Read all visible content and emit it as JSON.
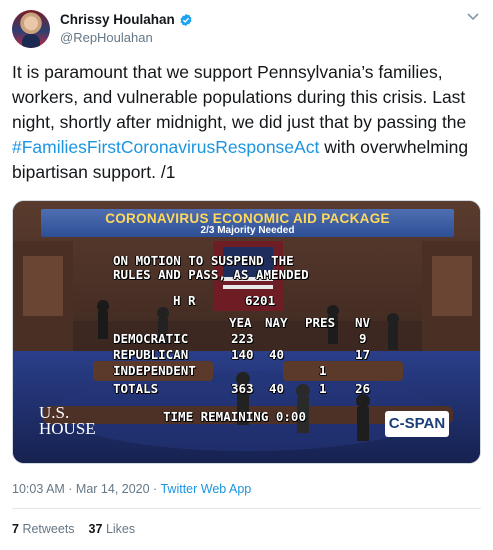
{
  "tweet": {
    "display_name": "Chrissy Houlahan",
    "handle": "@RepHoulahan",
    "verified": true,
    "text_before": "It is paramount that we support Pennsylvania’s families, workers, and vulnerable populations during this crisis. Last night, shortly after midnight, we did just that by passing the ",
    "hashtag": "#FamiliesFirstCoronavirusResponseAct",
    "text_after": " with overwhelming bipartisan support. /1",
    "timestamp": "10:03 AM · Mar 14, 2020 · ",
    "source": "Twitter Web App",
    "retweets_count": "7",
    "retweets_label": "Retweets",
    "likes_count": "37",
    "likes_label": "Likes"
  },
  "video": {
    "banner_title": "CORONAVIRUS ECONOMIC AID PACKAGE",
    "banner_subtitle": "2/3 Majority Needed",
    "motion_line1": "ON MOTION TO SUSPEND THE",
    "motion_line2": "RULES AND PASS, AS AMENDED",
    "bill_label": "H R",
    "bill_number": "6201",
    "columns": [
      "YEA",
      "NAY",
      "PRES",
      "NV"
    ],
    "rows": [
      {
        "party": "DEMOCRATIC",
        "yea": "223",
        "nay": "",
        "pres": "",
        "nv": "9"
      },
      {
        "party": "REPUBLICAN",
        "yea": "140",
        "nay": "40",
        "pres": "",
        "nv": "17"
      },
      {
        "party": "INDEPENDENT",
        "yea": "",
        "nay": "",
        "pres": "1",
        "nv": ""
      },
      {
        "party": "TOTALS",
        "yea": "363",
        "nay": "40",
        "pres": "1",
        "nv": "26"
      }
    ],
    "time_remaining": "TIME REMAINING 0:00",
    "house_logo_line1": "U.S.",
    "house_logo_line2": "HOUSE",
    "network_logo": "C-SPAN"
  },
  "colors": {
    "link": "#1b95e0",
    "muted": "#657786",
    "banner_text": "#ffd85c"
  }
}
